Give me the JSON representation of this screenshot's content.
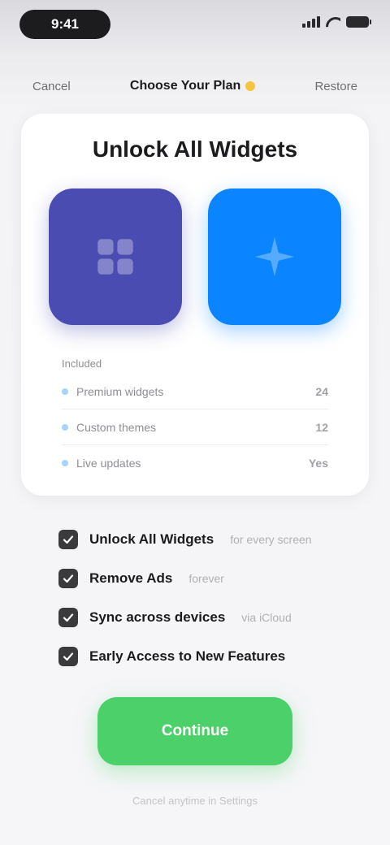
{
  "status_bar": {
    "time": "9:41"
  },
  "nav": {
    "left": "Cancel",
    "title": "Choose Your Plan",
    "right": "Restore"
  },
  "card": {
    "title": "Unlock All Widgets",
    "tile_left_icon": "grid-icon",
    "tile_right_icon": "sparkle-icon",
    "stats_header": "Included",
    "stats": [
      {
        "label": "Premium widgets",
        "value": "24"
      },
      {
        "label": "Custom themes",
        "value": "12"
      },
      {
        "label": "Live updates",
        "value": "Yes"
      }
    ]
  },
  "checklist": [
    {
      "label": "Unlock All Widgets",
      "sub": "for every screen"
    },
    {
      "label": "Remove Ads",
      "sub": "forever"
    },
    {
      "label": "Sync across devices",
      "sub": "via iCloud"
    },
    {
      "label": "Early Access to New Features",
      "sub": ""
    }
  ],
  "cta": {
    "label": "Continue"
  },
  "footer": {
    "note": "Cancel anytime in Settings"
  },
  "colors": {
    "tile_left": "#4a4cb2",
    "tile_right": "#0a84ff",
    "cta": "#4cd16a"
  }
}
